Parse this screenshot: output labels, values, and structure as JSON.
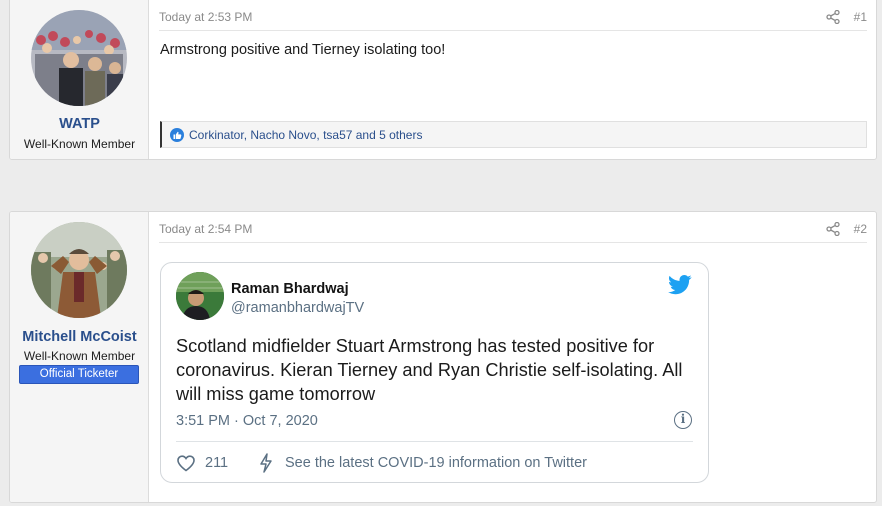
{
  "posts": [
    {
      "username": "WATP",
      "user_title": "Well-Known Member",
      "time": "Today at 2:53 PM",
      "number": "#1",
      "message": "Armstrong positive and Tierney isolating too!",
      "reactions": "Corkinator, Nacho Novo, tsa57 and 5 others",
      "icons": {
        "share": "share-icon",
        "reaction": "like-icon"
      }
    },
    {
      "username": "Mitchell McCoist",
      "user_title": "Well-Known Member",
      "banner": "Official Ticketer",
      "time": "Today at 2:54 PM",
      "number": "#2",
      "tweet": {
        "author_name": "Raman Bhardwaj",
        "handle": "@ramanbhardwajTV",
        "text": "Scotland midfielder Stuart Armstrong has tested positive for coronavirus. Kieran Tierney and Ryan Christie self-isolating. All will miss game tomorrow",
        "date": "3:51 PM · Oct 7, 2020",
        "likes": "211",
        "covid_link": "See the latest COVID-19 information on Twitter",
        "info_glyph": "i",
        "icons": {
          "brand": "twitter-bird-icon",
          "like": "heart-icon",
          "covid": "lightning-icon",
          "info": "info-icon"
        }
      }
    }
  ],
  "colors": {
    "username": "#2a4f8c",
    "banner": "#3b6fe0",
    "twitter_blue": "#1da1f2",
    "muted": "#5b7083",
    "page_bg": "#ececec"
  }
}
